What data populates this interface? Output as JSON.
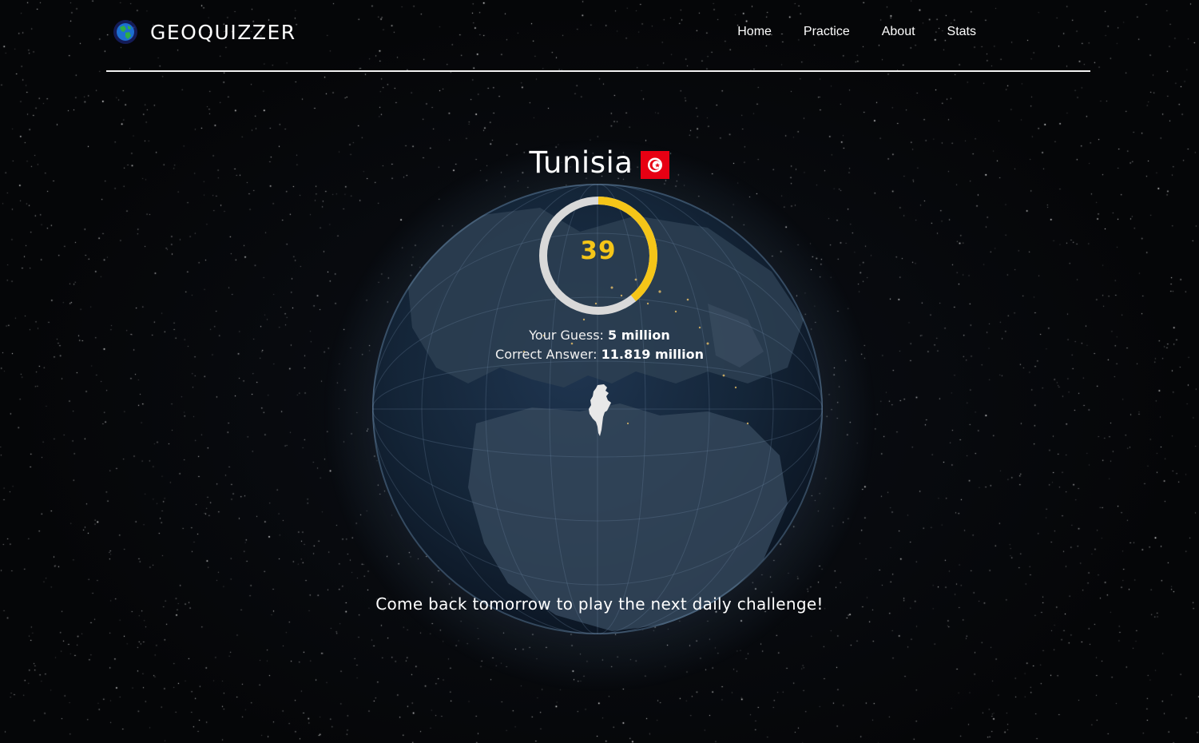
{
  "header": {
    "brand": "GEOQUIZZER",
    "logo_icon": "globe-icon",
    "nav": [
      {
        "label": "Home"
      },
      {
        "label": "Practice"
      },
      {
        "label": "About"
      },
      {
        "label": "Stats"
      }
    ]
  },
  "result": {
    "country": "Tunisia",
    "flag_icon": "tunisia-flag-icon",
    "score": "39",
    "score_fraction": 0.39,
    "guess_label": "Your Guess:",
    "guess_value": "5 million",
    "answer_label": "Correct Answer:",
    "answer_value": "11.819 million",
    "country_shape_icon": "tunisia-outline-icon"
  },
  "footer": {
    "message": "Come back tomorrow to play the next daily challenge!"
  },
  "colors": {
    "score_accent": "#f5c518",
    "ring_track": "#d9d9d9",
    "flag_red": "#e70013",
    "background": "#050608"
  }
}
